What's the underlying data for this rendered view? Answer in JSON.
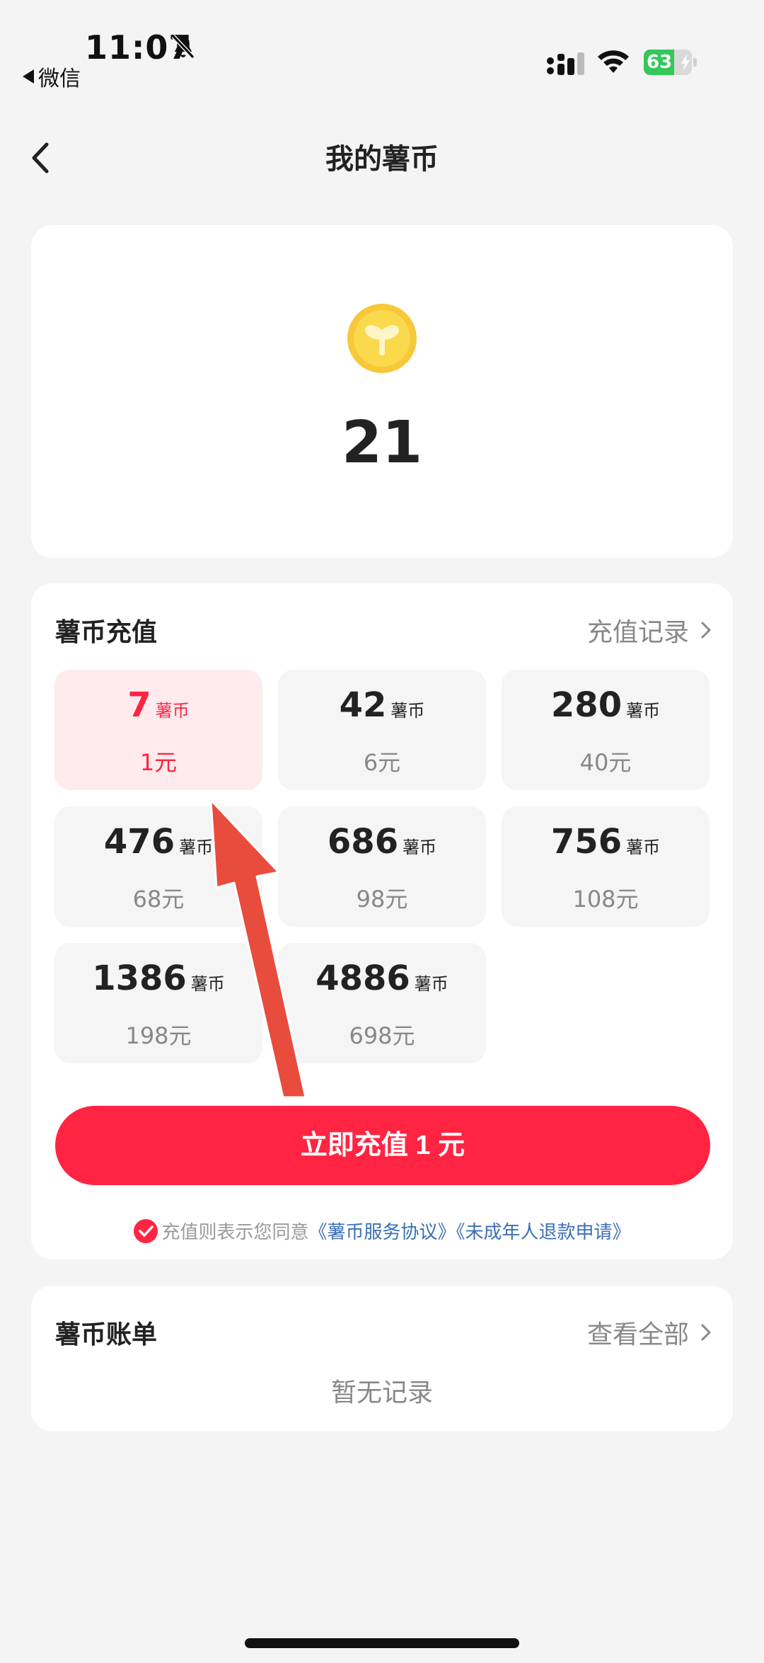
{
  "status_bar": {
    "time": "11:07",
    "back_app": "微信",
    "battery": "63",
    "battery_level_percent": 63,
    "icons": [
      "bell-slash-icon",
      "signal-icon",
      "wifi-icon",
      "battery-icon"
    ]
  },
  "nav": {
    "title": "我的薯币",
    "back_icon": "chevron-left-icon"
  },
  "balance": {
    "amount": "21",
    "icon": "coin-icon"
  },
  "recharge": {
    "title": "薯币充值",
    "history_link": "充值记录",
    "packages": [
      {
        "coins": "7",
        "unit": "薯币",
        "price": "1元",
        "selected": true
      },
      {
        "coins": "42",
        "unit": "薯币",
        "price": "6元",
        "selected": false
      },
      {
        "coins": "280",
        "unit": "薯币",
        "price": "40元",
        "selected": false
      },
      {
        "coins": "476",
        "unit": "薯币",
        "price": "68元",
        "selected": false
      },
      {
        "coins": "686",
        "unit": "薯币",
        "price": "98元",
        "selected": false
      },
      {
        "coins": "756",
        "unit": "薯币",
        "price": "108元",
        "selected": false
      },
      {
        "coins": "1386",
        "unit": "薯币",
        "price": "198元",
        "selected": false
      },
      {
        "coins": "4886",
        "unit": "薯币",
        "price": "698元",
        "selected": false
      }
    ],
    "pay_button": "立即充值 1 元",
    "agreement": {
      "text": "充值则表示您同意",
      "link1": "《薯币服务协议》",
      "link2": "《未成年人退款申请》"
    }
  },
  "bill": {
    "title": "薯币账单",
    "view_all": "查看全部",
    "empty": "暂无记录"
  },
  "colors": {
    "accent": "#ff2442",
    "selected_bg": "#ffeaed",
    "link": "#3b6fb6",
    "annotation_arrow": "#e84c3d"
  }
}
